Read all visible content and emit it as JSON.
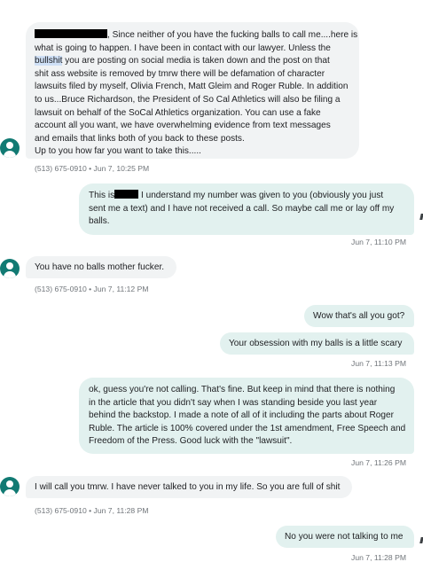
{
  "colors": {
    "incoming_bubble": "#f1f3f4",
    "outgoing_bubble": "#e2f1ef",
    "avatar": "#117a73",
    "timestamp_text": "#70757a",
    "redaction": "#000000",
    "selection_highlight": "#cfe0f6"
  },
  "messages": [
    {
      "direction": "incoming",
      "avatar_icon": "person-icon",
      "lines": [
        ", Since neither of you have the fucking balls to call me....here is",
        "what is going to happen. I have been in contact with our lawyer.  Unless the",
        "bullshit",
        " you are posting on social media is taken down and the post on that",
        "shit ass website is removed by  tmrw there will be defamation of character",
        "lawsuits filed by myself, Olivia French, Matt Gleim and Roger Ruble. In addition",
        "to us...Bruce Richardson, the President of So Cal Athletics will also be filing a",
        "lawsuit on behalf of the SoCal Athletics organization. You can use a fake",
        "account all you want, we have overwhelming evidence from text messages",
        "and emails that links both of you back to these posts.",
        "Up to you how far you want to take this....."
      ],
      "meta": "(513) 675-0910 • Jun 7, 10:25 PM"
    },
    {
      "direction": "outgoing",
      "lines": [
        "This is",
        " I understand my number was given to you (obviously you just",
        "sent me a text) and I have not received a call. So maybe call me or lay off my",
        "balls."
      ],
      "meta": "Jun 7, 11:10 PM"
    },
    {
      "direction": "incoming",
      "avatar_icon": "person-icon",
      "lines": [
        "You have no balls mother fucker."
      ],
      "meta": "(513) 675-0910 • Jun 7, 11:12 PM"
    },
    {
      "direction": "outgoing",
      "lines": [
        "Wow that's all you got?"
      ]
    },
    {
      "direction": "outgoing",
      "lines": [
        "Your obsession with my balls is a little scary"
      ],
      "meta": "Jun 7, 11:13 PM"
    },
    {
      "direction": "outgoing",
      "lines": [
        "ok, guess you're not calling. That's fine. But keep in mind that there is nothing",
        "in the article that you didn't say when I was standing beside you last year",
        "behind the backstop. I made a note of all of it including the parts about Roger",
        "Ruble. The article is 100% covered under the 1st amendment, Free Speech and",
        "Freedom of the Press. Good luck with the \"lawsuit\"."
      ],
      "meta": "Jun 7, 11:26 PM"
    },
    {
      "direction": "incoming",
      "avatar_icon": "person-icon",
      "lines": [
        "I will call you tmrw. I have never talked to you in my life. So you are full of shit"
      ],
      "meta": "(513) 675-0910 • Jun 7, 11:28 PM"
    },
    {
      "direction": "outgoing",
      "lines": [
        "No you were not talking to me"
      ],
      "meta": "Jun 7, 11:28 PM"
    }
  ]
}
